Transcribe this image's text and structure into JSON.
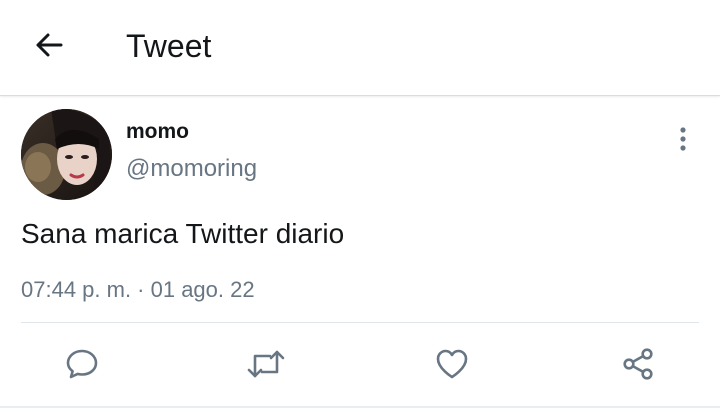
{
  "header": {
    "title": "Tweet",
    "back_icon": "arrow-left-icon"
  },
  "tweet": {
    "author": {
      "display_name": "momo",
      "handle": "@momoring",
      "avatar_icon": "profile-photo"
    },
    "text": "Sana marica Twitter diario",
    "timestamp": "07:44 p. m. · 01 ago. 22"
  },
  "actions": [
    {
      "name": "reply",
      "icon": "reply-icon"
    },
    {
      "name": "retweet",
      "icon": "retweet-icon"
    },
    {
      "name": "like",
      "icon": "heart-icon"
    },
    {
      "name": "share",
      "icon": "share-icon"
    }
  ],
  "colors": {
    "text_primary": "#14171a",
    "text_secondary": "#687684",
    "icon": "#687684",
    "divider": "#e1e6ea"
  }
}
